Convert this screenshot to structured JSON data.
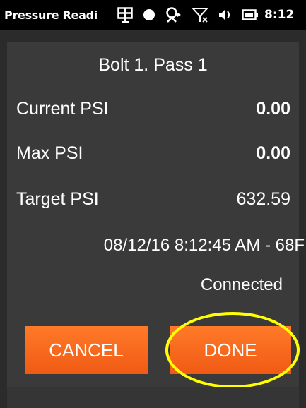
{
  "status_bar": {
    "app_title": "Pressure Readi",
    "time": "8:12",
    "icons": [
      "app-grid-icon",
      "record-dot-icon",
      "network-sync-icon",
      "no-signal-icon",
      "speaker-icon",
      "battery-icon"
    ]
  },
  "reading": {
    "heading": "Bolt 1. Pass 1",
    "rows": [
      {
        "label": "Current PSI",
        "value": "0.00"
      },
      {
        "label": "Max PSI",
        "value": "0.00"
      },
      {
        "label": "Target PSI",
        "value": "632.59"
      }
    ],
    "timestamp": "08/12/16  8:12:45 AM - 68F",
    "connection_status": "Connected"
  },
  "actions": {
    "cancel_label": "CANCEL",
    "done_label": "DONE"
  },
  "colors": {
    "button": "#f26a1b",
    "highlight": "#ffff00",
    "panel": "#3a3a3a",
    "status_bar": "#000000"
  }
}
